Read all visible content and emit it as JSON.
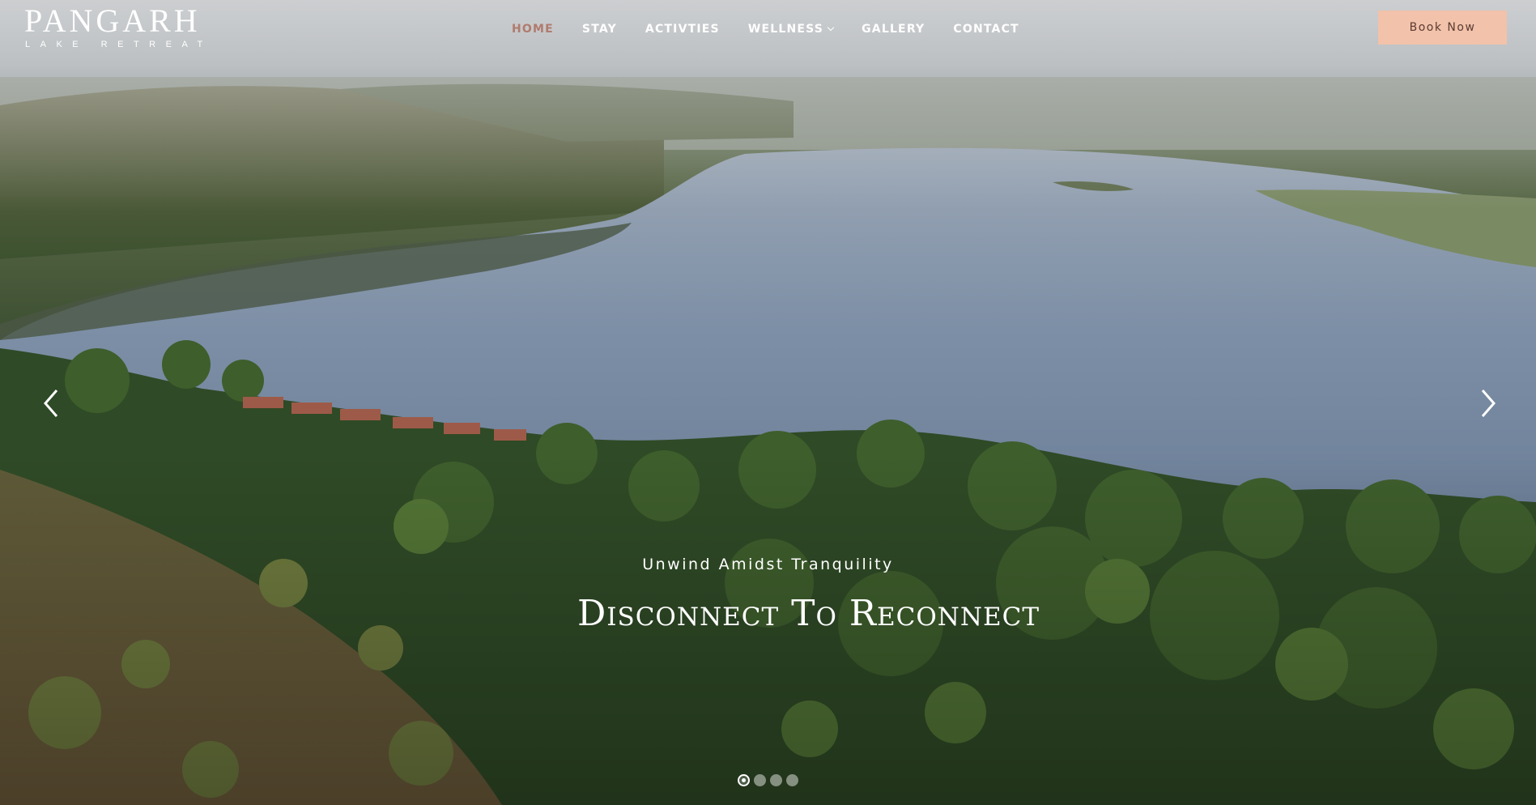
{
  "brand": {
    "name": "PANGARH",
    "tagline": "LAKE RETREAT"
  },
  "nav": {
    "items": [
      {
        "label": "HOME",
        "active": true
      },
      {
        "label": "STAY"
      },
      {
        "label": "ACTIVTIES"
      },
      {
        "label": "WELLNESS",
        "has_dropdown": true
      },
      {
        "label": "GALLERY"
      },
      {
        "label": "CONTACT"
      }
    ]
  },
  "header": {
    "book_label": "Book Now"
  },
  "hero": {
    "subtitle": "Unwind Amidst Tranquility",
    "title": "Disconnect To Reconnect",
    "prev_icon": "chevron-left-icon",
    "next_icon": "chevron-right-icon",
    "slide_count": 4,
    "active_slide": 1
  },
  "colors": {
    "accent": "#b07b6e",
    "book_button": "#f2c2aa",
    "water": "#7f91a6"
  }
}
